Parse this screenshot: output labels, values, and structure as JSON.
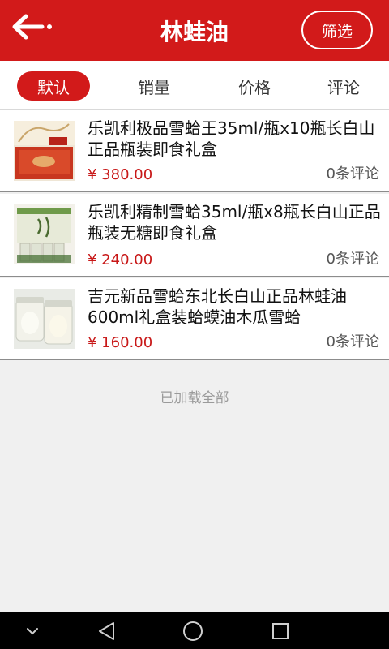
{
  "header": {
    "title": "林蛙油",
    "filter_label": "筛选",
    "back_icon": "back-arrow-icon"
  },
  "tabs": [
    {
      "label": "默认",
      "active": true
    },
    {
      "label": "销量",
      "active": false
    },
    {
      "label": "价格",
      "active": false
    },
    {
      "label": "评论",
      "active": false
    }
  ],
  "products": [
    {
      "name": "乐凯利极品雪蛤王35ml/瓶x10瓶长白山正品瓶装即食礼盒",
      "price": "¥ 380.00",
      "reviews": "0条评论"
    },
    {
      "name": "乐凯利精制雪蛤35ml/瓶x8瓶长白山正品瓶装无糖即食礼盒",
      "price": "¥ 240.00",
      "reviews": "0条评论"
    },
    {
      "name": "吉元新品雪蛤东北长白山正品林蛙油600ml礼盒装蛤蟆油木瓜雪蛤",
      "price": "¥ 160.00",
      "reviews": "0条评论"
    }
  ],
  "footer_text": "已加载全部",
  "system_nav": {
    "icons": [
      "hide-keyboard-icon",
      "back-triangle-icon",
      "home-circle-icon",
      "recent-apps-square-icon"
    ]
  },
  "colors": {
    "accent": "#d21a1a",
    "price": "#c81818",
    "background": "#f0f0f0"
  }
}
